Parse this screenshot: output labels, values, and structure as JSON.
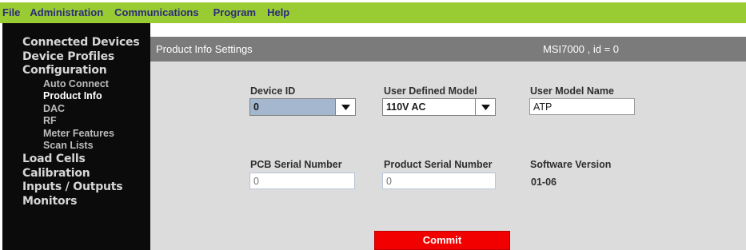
{
  "menubar": {
    "items": [
      "File",
      "Administration",
      "Communications",
      "Program",
      "Help"
    ]
  },
  "sidebar": {
    "items": [
      {
        "label": "Connected Devices",
        "level": 0
      },
      {
        "label": "Device Profiles",
        "level": 0
      },
      {
        "label": "Configuration",
        "level": 0
      },
      {
        "label": "Auto Connect",
        "level": 1
      },
      {
        "label": "Product Info",
        "level": 1,
        "selected": true
      },
      {
        "label": "DAC",
        "level": 1
      },
      {
        "label": "RF",
        "level": 1
      },
      {
        "label": "Meter Features",
        "level": 1
      },
      {
        "label": "Scan Lists",
        "level": 1
      },
      {
        "label": "Load Cells",
        "level": 0
      },
      {
        "label": "Calibration",
        "level": 0
      },
      {
        "label": "Inputs / Outputs",
        "level": 0
      },
      {
        "label": "Monitors",
        "level": 0
      }
    ]
  },
  "header": {
    "title": "Product Info Settings",
    "device": "MSI7000 , id = 0"
  },
  "form": {
    "device_id": {
      "label": "Device ID",
      "value": "0"
    },
    "user_defined_model": {
      "label": "User Defined Model",
      "value": "110V AC"
    },
    "user_model_name": {
      "label": "User Model Name",
      "value": "ATP"
    },
    "pcb_serial": {
      "label": "PCB Serial Number",
      "placeholder": "0"
    },
    "product_serial": {
      "label": "Product Serial Number",
      "placeholder": "0"
    },
    "software_version": {
      "label": "Software Version",
      "value": "01-06"
    },
    "commit_label": "Commit"
  },
  "colors": {
    "menubar": "#99cc33",
    "sidebar": "#0b0b0b",
    "header": "#7b7b7b",
    "panel": "#dcdcdc",
    "device_id_combo": "#a4b7cf",
    "commit": "#f20000"
  }
}
